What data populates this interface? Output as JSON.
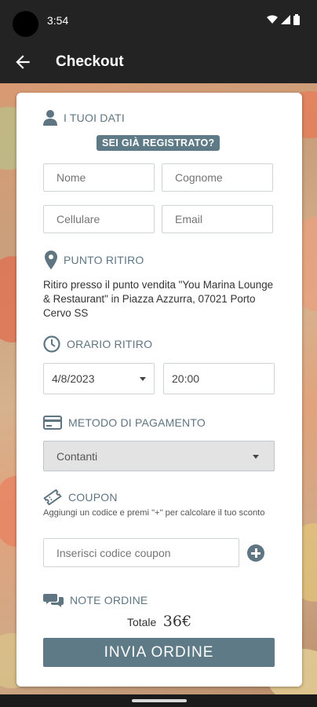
{
  "status": {
    "time": "3:54"
  },
  "app_bar": {
    "title": "Checkout"
  },
  "sections": {
    "your_data": "I TUOI DATI",
    "pickup_point": "PUNTO RITIRO",
    "pickup_time": "ORARIO RITIRO",
    "payment_method": "METODO DI PAGAMENTO",
    "coupon": "COUPON",
    "order_notes": "NOTE ORDINE"
  },
  "already_registered": "SEI GIÀ REGISTRATO?",
  "fields": {
    "first_name_placeholder": "Nome",
    "last_name_placeholder": "Cognome",
    "phone_placeholder": "Cellulare",
    "email_placeholder": "Email",
    "coupon_placeholder": "Inserisci codice coupon"
  },
  "pickup_address": "Ritiro presso il punto vendita \"You Marina Lounge & Restaurant\" in Piazza Azzurra, 07021 Porto Cervo SS",
  "pickup": {
    "date": "4/8/2023",
    "time": "20:00"
  },
  "payment": {
    "selected": "Contanti"
  },
  "coupon_hint": "Aggiungi un codice e premi \"+\" per calcolare il tuo sconto",
  "total": {
    "label": "Totale",
    "amount": "36€"
  },
  "submit_label": "INVIA ORDINE",
  "colors": {
    "accent": "#5f7a87",
    "icon": "#5f7582",
    "bar": "#232323"
  },
  "icons": [
    "back-arrow-icon",
    "user-icon",
    "location-pin-icon",
    "clock-icon",
    "credit-card-icon",
    "ticket-icon",
    "chat-bubbles-icon",
    "add-circle-icon"
  ]
}
